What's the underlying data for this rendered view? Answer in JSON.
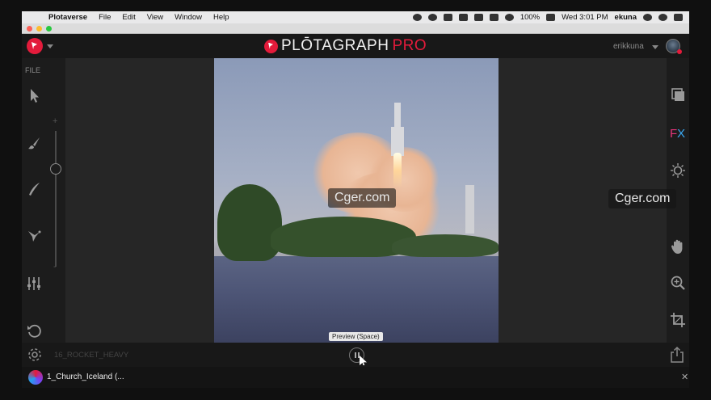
{
  "menubar": {
    "apple": "",
    "app_name": "Plotaverse",
    "items": [
      "File",
      "Edit",
      "View",
      "Window",
      "Help"
    ],
    "battery": "100%",
    "clock": "Wed 3:01 PM",
    "user": "ekuna"
  },
  "header": {
    "brand_name": "PLŌTAGRAPH",
    "brand_suffix": "PRO",
    "username": "erikkuna"
  },
  "left_toolbar": {
    "file_label": "FILE"
  },
  "canvas": {
    "watermark_left": "Cger.com",
    "watermark_right": "Cger.com"
  },
  "bottom_bar": {
    "filename": "16_ROCKET_HEAVY",
    "tooltip": "Preview (Space)"
  },
  "tab_bar": {
    "tab_label": "1_Church_Iceland (..."
  },
  "colors": {
    "brand_red": "#e31b3b",
    "fx_pink": "#e6357a",
    "fx_blue": "#3aa7f0"
  }
}
